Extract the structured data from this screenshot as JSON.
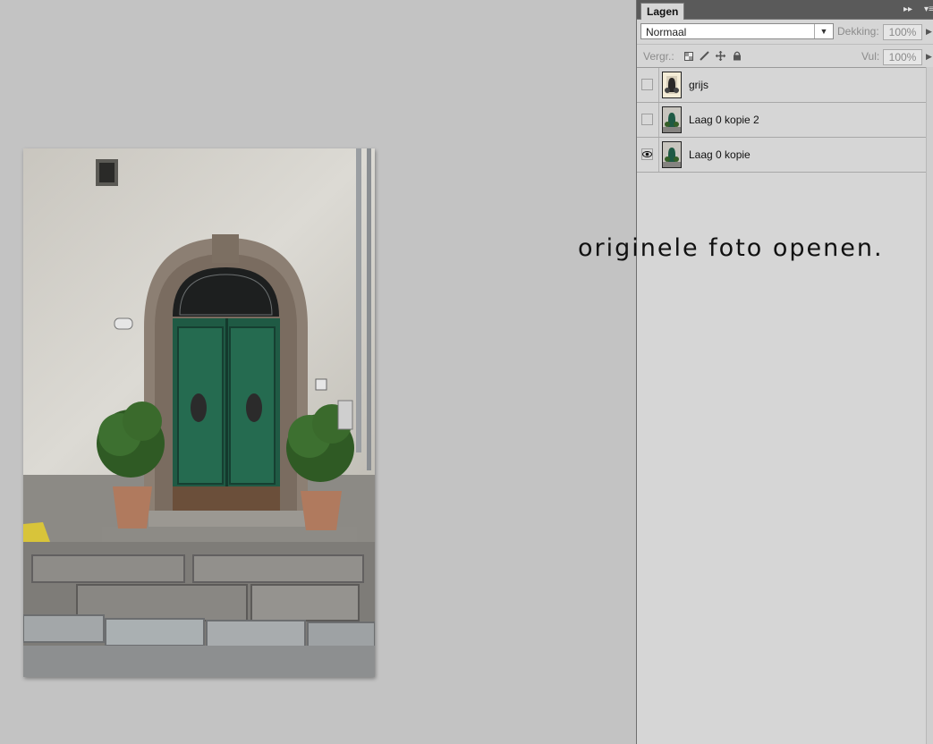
{
  "caption": "originele foto openen.",
  "panel": {
    "tab_label": "Lagen",
    "blend_mode": "Normaal",
    "opacity_label": "Dekking:",
    "opacity_value": "100%",
    "lock_label": "Vergr.:",
    "fill_label": "Vul:",
    "fill_value": "100%",
    "lock_icons": [
      "lock-transparent-icon",
      "lock-brush-icon",
      "lock-move-icon",
      "lock-all-icon"
    ]
  },
  "layers": [
    {
      "name": "grijs",
      "visible": false,
      "thumb": "grayscale"
    },
    {
      "name": "Laag 0 kopie 2",
      "visible": false,
      "thumb": "color"
    },
    {
      "name": "Laag 0 kopie",
      "visible": true,
      "thumb": "color"
    }
  ]
}
